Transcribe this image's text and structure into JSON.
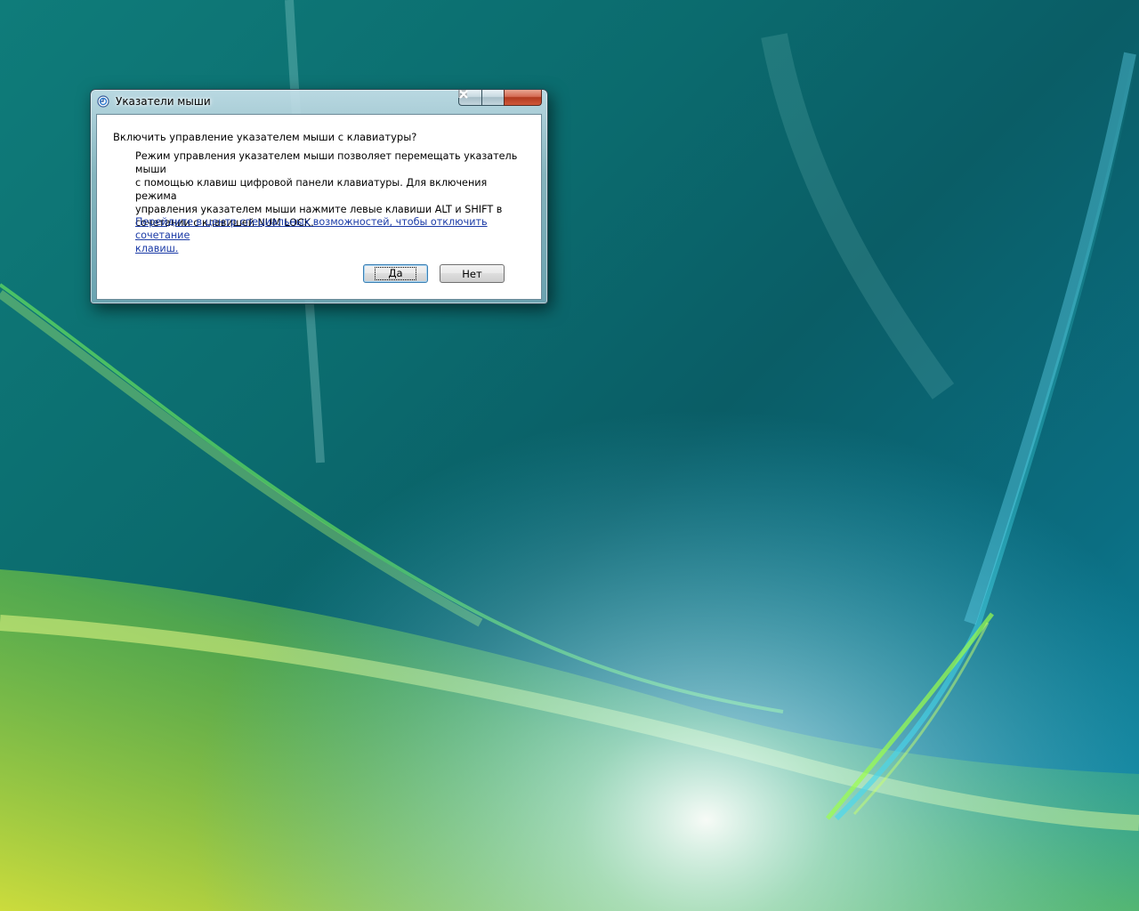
{
  "window": {
    "title": "Указатели мыши"
  },
  "dialog": {
    "question": "Включить управление указателем мыши с клавиатуры?",
    "description": "Режим управления указателем мыши позволяет перемещать указатель мыши\nс помощью клавиш цифровой панели клавиатуры.  Для включения режима\nуправления указателем мыши нажмите левые клавиши ALT и SHIFT в\nсочетании с клавишей NUM LOCK.",
    "link": "Перейдите в центр специальных возможностей, чтобы отключить сочетание\nклавиш.",
    "yes_label": "Да",
    "no_label": "Нет"
  },
  "icons": {
    "window_icon": "ease-of-access-icon",
    "minimize": "minimize-icon",
    "maximize": "maximize-icon",
    "close": "close-icon"
  },
  "colors": {
    "close_button": "#c8472b",
    "link": "#1a3aa6",
    "desktop_teal": "#0b6b6e"
  }
}
